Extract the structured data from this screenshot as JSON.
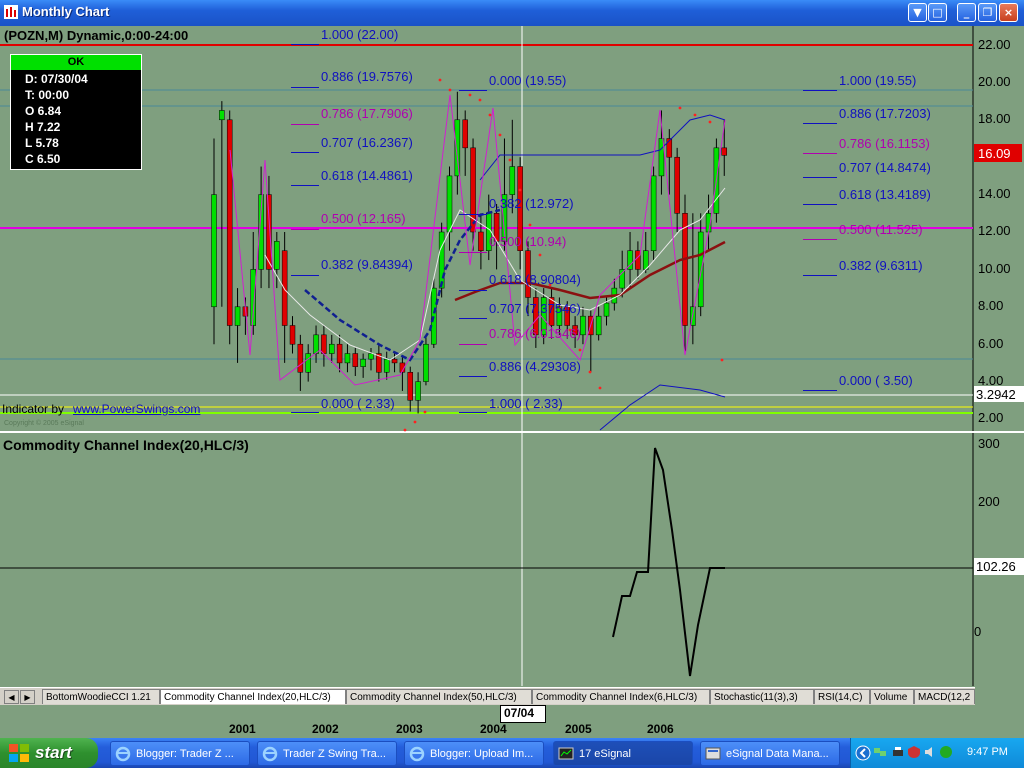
{
  "window": {
    "title": "Monthly Chart",
    "minimize": "_",
    "restore": "❐",
    "close": "×"
  },
  "chart_header": "(POZN,M) Dynamic,0:00-24:00",
  "ohlc_box": {
    "status": "OK",
    "date": "D: 07/30/04",
    "time": "T: 00:00",
    "open": "O  6.84",
    "high": "H  7.22",
    "low": "L  5.78",
    "close": "C  6.50"
  },
  "price_axis": {
    "labels": [
      "22.00",
      "20.00",
      "18.00",
      "16.00",
      "14.00",
      "12.00",
      "10.00",
      "8.00",
      "6.00",
      "4.00",
      "2.00"
    ],
    "last_price": "16.09",
    "indicator_value": "3.2942"
  },
  "fib_sets": [
    {
      "levels": [
        "1.000 (22.00)",
        "0.886 (19.7576)",
        "0.786 (17.7906)",
        "0.707 (16.2367)",
        "0.618 (14.4861)",
        "0.500 (12.165)",
        "0.382 (9.84394)",
        "0.000 ( 2.33)"
      ]
    },
    {
      "levels": [
        "0.000 (19.55)",
        "0.382 (12.972)",
        "0.500 (10.94)",
        "0.618 (8.90804)",
        "0.707 (7.37546)",
        "0.786 (6.01546)",
        "0.886 (4.29308)",
        "1.000 ( 2.33)"
      ]
    },
    {
      "levels": [
        "1.000 (19.55)",
        "0.886 (17.7203)",
        "0.786 (16.1153)",
        "0.707 (14.8474)",
        "0.618 (13.4189)",
        "0.500 (11.525)",
        "0.382 (9.6311)",
        "0.000 ( 3.50)"
      ]
    }
  ],
  "indicator_credit": "Indicator by",
  "indicator_link": "www.PowerSwings.com",
  "copyright": "Copyright © 2005 eSignal",
  "cci": {
    "title": "Commodity Channel Index(20,HLC/3)",
    "axis_labels": [
      "300",
      "200",
      "100",
      "0"
    ],
    "current": "102.26"
  },
  "tabs": [
    "BottomWoodieCCI 1.21",
    "Commodity Channel Index(20,HLC/3)",
    "Commodity Channel Index(50,HLC/3)",
    "Commodity Channel Index(6,HLC/3)",
    "Stochastic(11(3),3)",
    "RSI(14,C)",
    "Volume",
    "MACD(12,2"
  ],
  "x_axis": {
    "years": [
      "2001",
      "2002",
      "2003",
      "2004",
      "2005",
      "2006"
    ],
    "cursor_label": "07/04"
  },
  "taskbar": {
    "start": "start",
    "tasks": [
      "Blogger: Trader Z ...",
      "Trader Z Swing Tra...",
      "Blogger: Upload Im...",
      "17 eSignal",
      "eSignal Data Mana..."
    ],
    "clock": "9:47 PM"
  },
  "colors": {
    "chart_bg": "#7f9f7f",
    "up_candle": "#00e000",
    "down_candle": "#e00000",
    "fib_blue": "#1010c0",
    "fib_magenta": "#b000b0"
  }
}
